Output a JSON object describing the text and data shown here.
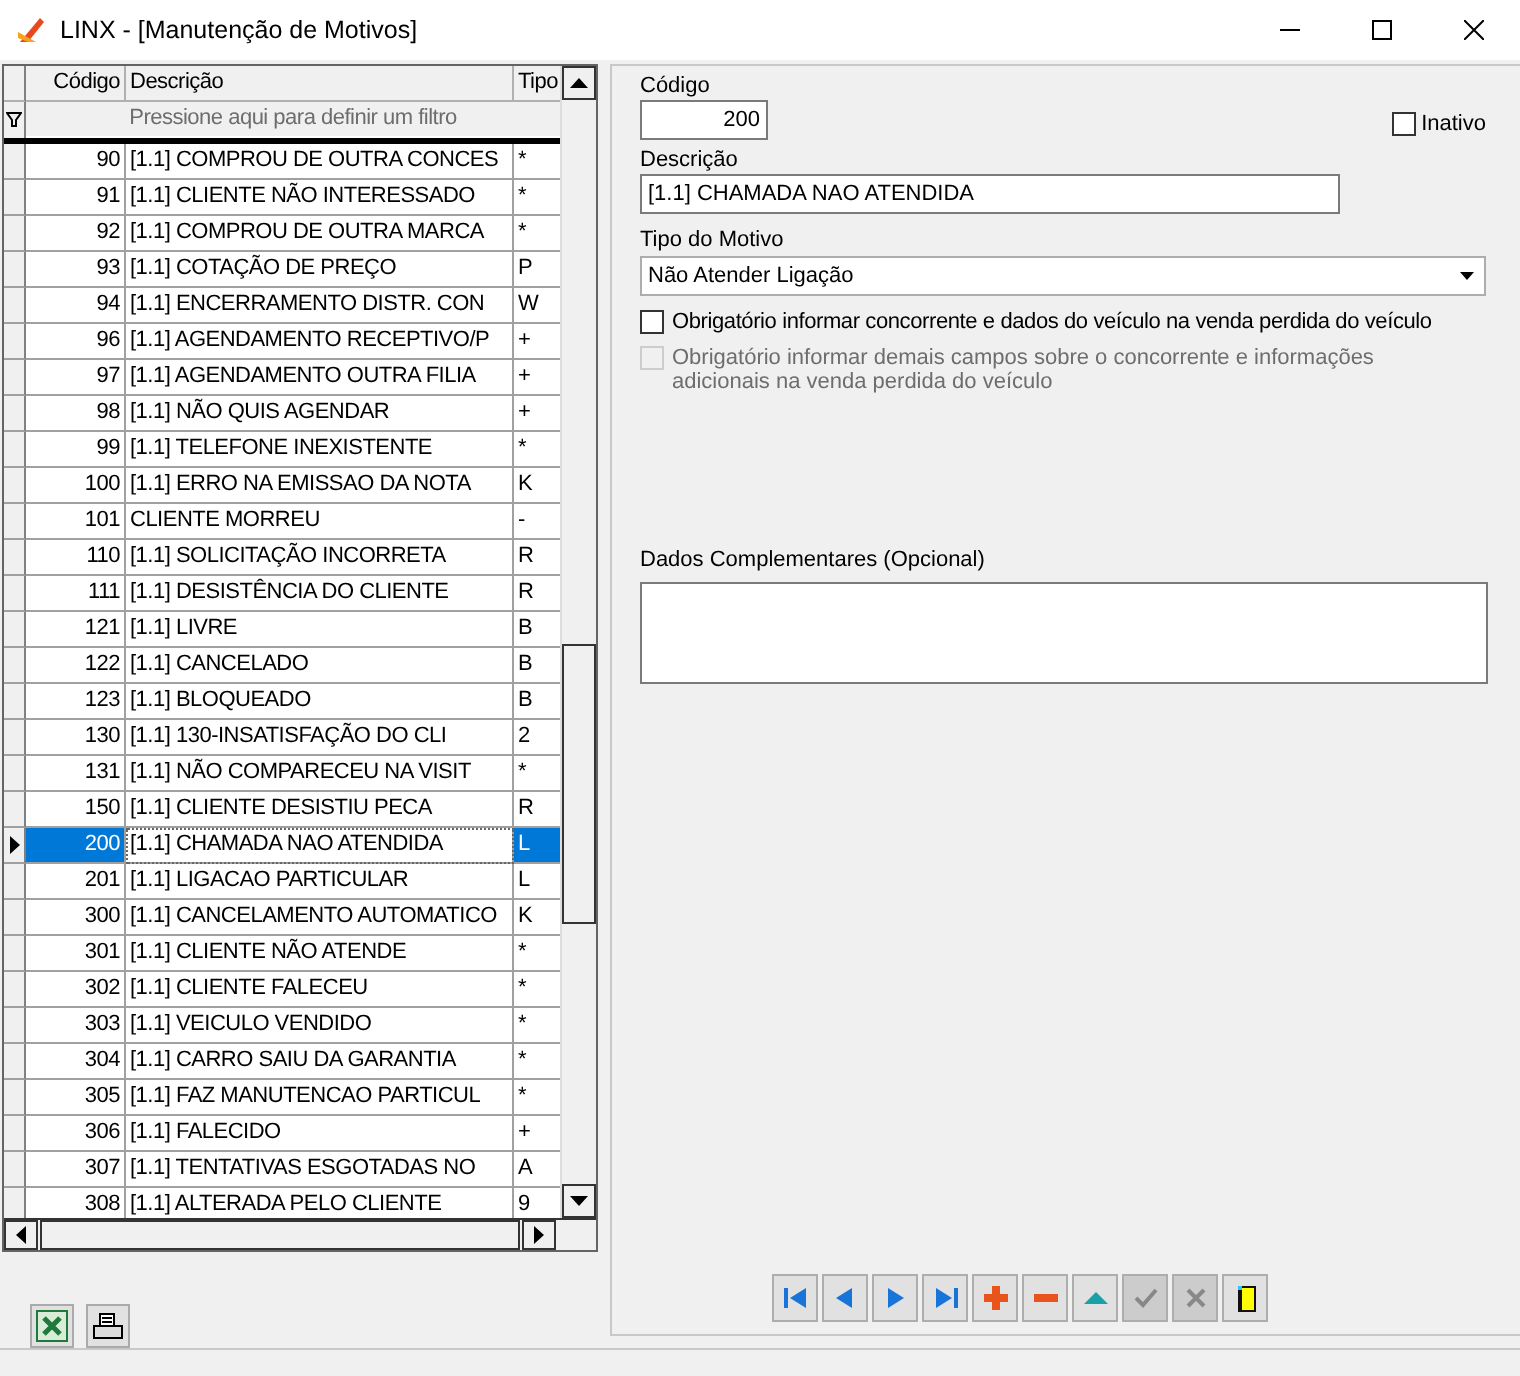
{
  "window": {
    "title": "LINX - [Manutenção de Motivos]"
  },
  "grid": {
    "columns": [
      "Código",
      "Descrição",
      "Tipo"
    ],
    "filter_placeholder": "Pressione aqui para definir um filtro",
    "rows": [
      {
        "codigo": "90",
        "descricao": "[1.1] COMPROU DE OUTRA CONCES",
        "tipo": "*",
        "selected": false
      },
      {
        "codigo": "91",
        "descricao": "[1.1] CLIENTE NÃO INTERESSADO",
        "tipo": "*",
        "selected": false
      },
      {
        "codigo": "92",
        "descricao": "[1.1] COMPROU DE OUTRA MARCA",
        "tipo": "*",
        "selected": false
      },
      {
        "codigo": "93",
        "descricao": "[1.1] COTAÇÃO DE PREÇO",
        "tipo": "P",
        "selected": false
      },
      {
        "codigo": "94",
        "descricao": "[1.1] ENCERRAMENTO DISTR. CON",
        "tipo": "W",
        "selected": false
      },
      {
        "codigo": "96",
        "descricao": "[1.1] AGENDAMENTO RECEPTIVO/P",
        "tipo": "+",
        "selected": false
      },
      {
        "codigo": "97",
        "descricao": "[1.1] AGENDAMENTO OUTRA FILIA",
        "tipo": "+",
        "selected": false
      },
      {
        "codigo": "98",
        "descricao": "[1.1] NÃO QUIS AGENDAR",
        "tipo": "+",
        "selected": false
      },
      {
        "codigo": "99",
        "descricao": "[1.1] TELEFONE INEXISTENTE",
        "tipo": "*",
        "selected": false
      },
      {
        "codigo": "100",
        "descricao": "[1.1] ERRO NA EMISSAO DA NOTA",
        "tipo": "K",
        "selected": false
      },
      {
        "codigo": "101",
        "descricao": "CLIENTE MORREU",
        "tipo": "-",
        "selected": false
      },
      {
        "codigo": "110",
        "descricao": "[1.1] SOLICITAÇÃO INCORRETA",
        "tipo": "R",
        "selected": false
      },
      {
        "codigo": "111",
        "descricao": "[1.1] DESISTÊNCIA DO CLIENTE",
        "tipo": "R",
        "selected": false
      },
      {
        "codigo": "121",
        "descricao": "[1.1] LIVRE",
        "tipo": "B",
        "selected": false
      },
      {
        "codigo": "122",
        "descricao": "[1.1] CANCELADO",
        "tipo": "B",
        "selected": false
      },
      {
        "codigo": "123",
        "descricao": "[1.1] BLOQUEADO",
        "tipo": "B",
        "selected": false
      },
      {
        "codigo": "130",
        "descricao": "[1.1] 130-INSATISFAÇÃO DO CLI",
        "tipo": "2",
        "selected": false
      },
      {
        "codigo": "131",
        "descricao": "[1.1] NÃO COMPARECEU NA VISIT",
        "tipo": "*",
        "selected": false
      },
      {
        "codigo": "150",
        "descricao": "[1.1] CLIENTE DESISTIU PECA",
        "tipo": "R",
        "selected": false
      },
      {
        "codigo": "200",
        "descricao": "[1.1] CHAMADA NAO ATENDIDA",
        "tipo": "L",
        "selected": true
      },
      {
        "codigo": "201",
        "descricao": "[1.1] LIGACAO PARTICULAR",
        "tipo": "L",
        "selected": false
      },
      {
        "codigo": "300",
        "descricao": "[1.1] CANCELAMENTO AUTOMATICO",
        "tipo": "K",
        "selected": false
      },
      {
        "codigo": "301",
        "descricao": "[1.1] CLIENTE NÃO ATENDE",
        "tipo": "*",
        "selected": false
      },
      {
        "codigo": "302",
        "descricao": "[1.1]  CLIENTE FALECEU",
        "tipo": "*",
        "selected": false
      },
      {
        "codigo": "303",
        "descricao": "[1.1] VEICULO VENDIDO",
        "tipo": "*",
        "selected": false
      },
      {
        "codigo": "304",
        "descricao": "[1.1] CARRO SAIU DA GARANTIA",
        "tipo": "*",
        "selected": false
      },
      {
        "codigo": "305",
        "descricao": "[1.1] FAZ MANUTENCAO PARTICUL",
        "tipo": "*",
        "selected": false
      },
      {
        "codigo": "306",
        "descricao": "[1.1] FALECIDO",
        "tipo": "+",
        "selected": false
      },
      {
        "codigo": "307",
        "descricao": "[1.1] TENTATIVAS ESGOTADAS NO",
        "tipo": "A",
        "selected": false
      },
      {
        "codigo": "308",
        "descricao": "[1.1] ALTERADA PELO CLIENTE",
        "tipo": "9",
        "selected": false
      }
    ]
  },
  "form": {
    "codigo_label": "Código",
    "codigo": "200",
    "inativo": {
      "label": "Inativo",
      "checked": false
    },
    "descricao_label": "Descrição",
    "descricao": "[1.1] CHAMADA NAO ATENDIDA",
    "tipo_label": "Tipo do Motivo",
    "tipo": "Não Atender Ligação",
    "options": [
      {
        "label": "Obrigatório informar concorrente e dados do veículo na venda perdida do veículo",
        "checked": false,
        "disabled": false
      },
      {
        "label": "Obrigatório informar demais campos sobre o concorrente e informações adicionais na venda perdida do veículo",
        "checked": false,
        "disabled": true
      }
    ],
    "complementares_label": "Dados Complementares (Opcional)"
  },
  "nav_buttons": [
    {
      "kind": "first",
      "disabled": false
    },
    {
      "kind": "prev",
      "disabled": false
    },
    {
      "kind": "next",
      "disabled": false
    },
    {
      "kind": "last",
      "disabled": false
    },
    {
      "kind": "add",
      "disabled": false
    },
    {
      "kind": "remove",
      "disabled": false
    },
    {
      "kind": "up",
      "disabled": false
    },
    {
      "kind": "confirm",
      "disabled": true
    },
    {
      "kind": "cancel",
      "disabled": true
    },
    {
      "kind": "exit",
      "disabled": false
    }
  ]
}
